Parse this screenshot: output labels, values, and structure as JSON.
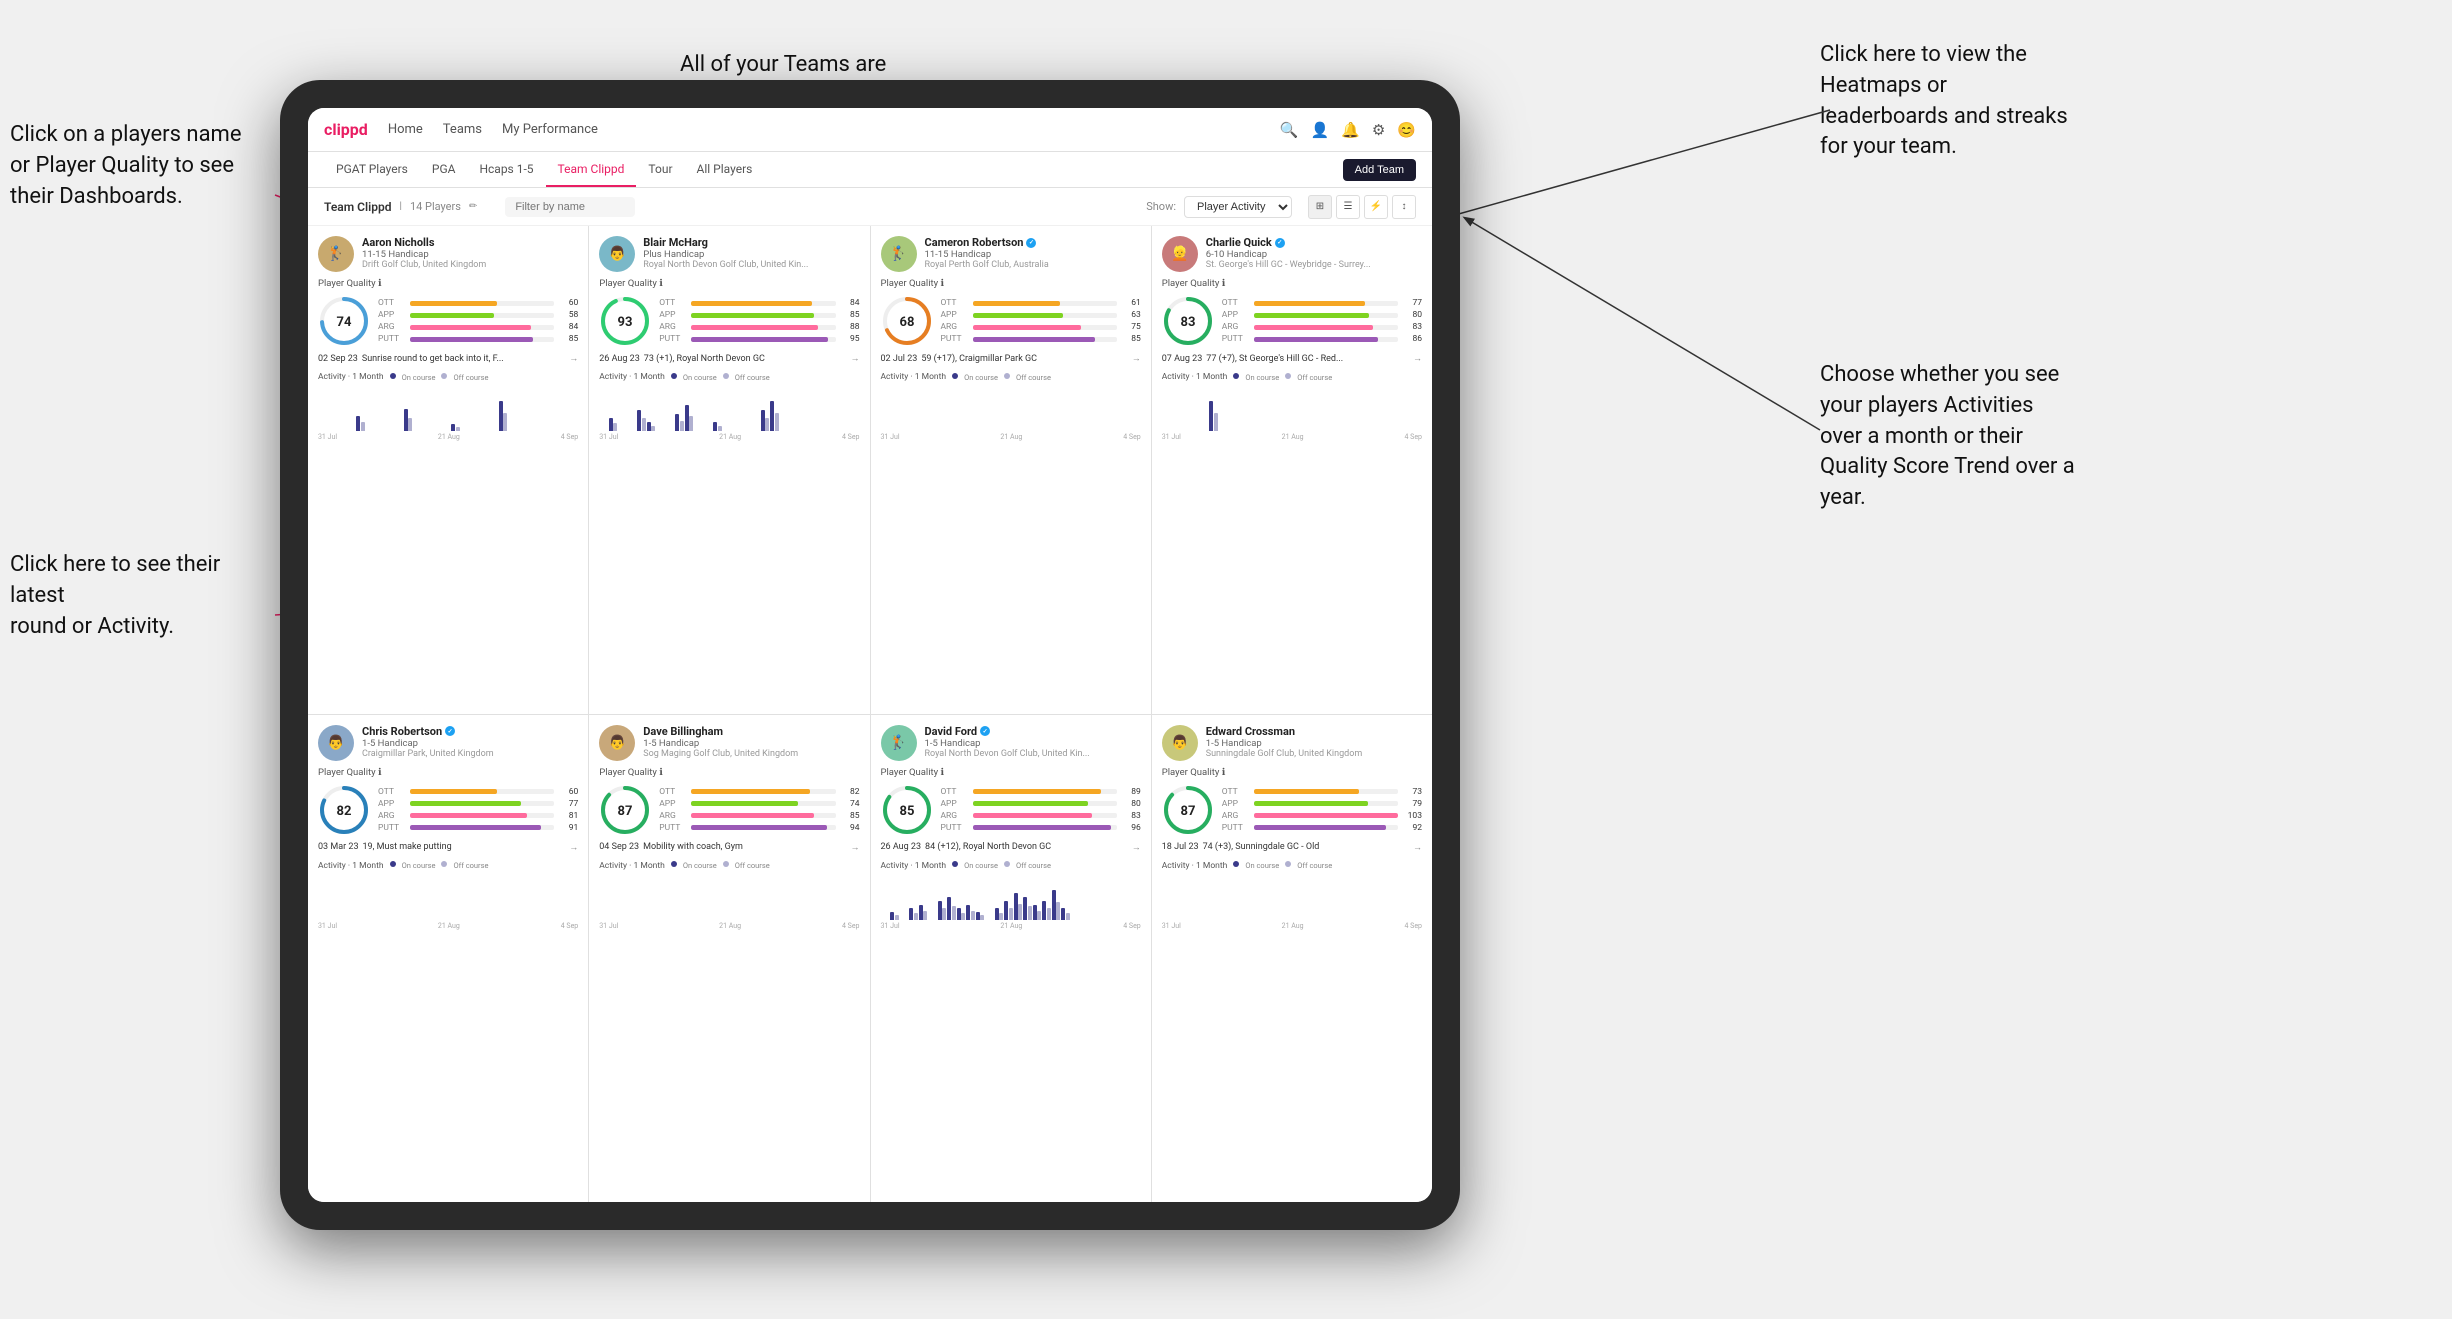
{
  "annotations": {
    "top_center": "All of your Teams are here.",
    "top_right_title": "Click here to view the",
    "top_right_body": "Heatmaps or leaderboards\nand streaks for your team.",
    "left_top_title": "Click on a players name",
    "left_top_body": "or Player Quality to see\ntheir Dashboards.",
    "left_bottom_title": "Click here to see their latest",
    "left_bottom_body": "round or Activity.",
    "right_bottom_title": "Choose whether you see",
    "right_bottom_body": "your players Activities over\na month or their Quality\nScore Trend over a year."
  },
  "nav": {
    "logo": "clippd",
    "items": [
      "Home",
      "Teams",
      "My Performance"
    ],
    "add_team": "Add Team"
  },
  "sub_nav": {
    "items": [
      "PGAT Players",
      "PGA",
      "Hcaps 1-5",
      "Team Clippd",
      "Tour",
      "All Players"
    ]
  },
  "team": {
    "name": "Team Clippd",
    "count": "14 Players",
    "search_placeholder": "Filter by name",
    "show_label": "Show:",
    "show_value": "Player Activity"
  },
  "players": [
    {
      "name": "Aaron Nicholls",
      "handicap": "11-15 Handicap",
      "club": "Drift Golf Club, United Kingdom",
      "score": 74,
      "score_color": "#4a9fd8",
      "stats": [
        {
          "label": "OTT",
          "value": 60,
          "color": "#f5a623"
        },
        {
          "label": "APP",
          "value": 58,
          "color": "#7ed321"
        },
        {
          "label": "ARG",
          "value": 84,
          "color": "#ff6b9d"
        },
        {
          "label": "PUTT",
          "value": 85,
          "color": "#9b59b6"
        }
      ],
      "recent_date": "02 Sep 23",
      "recent_text": "Sunrise round to get back into it, F...",
      "chart_bars": [
        0,
        0,
        0,
        0,
        2,
        0,
        0,
        0,
        0,
        3,
        0,
        0,
        0,
        0,
        1,
        0,
        0,
        0,
        0,
        4
      ]
    },
    {
      "name": "Blair McHarg",
      "handicap": "Plus Handicap",
      "club": "Royal North Devon Golf Club, United Kin...",
      "score": 93,
      "score_color": "#2ecc71",
      "stats": [
        {
          "label": "OTT",
          "value": 84,
          "color": "#f5a623"
        },
        {
          "label": "APP",
          "value": 85,
          "color": "#7ed321"
        },
        {
          "label": "ARG",
          "value": 88,
          "color": "#ff6b9d"
        },
        {
          "label": "PUTT",
          "value": 95,
          "color": "#9b59b6"
        }
      ],
      "recent_date": "26 Aug 23",
      "recent_text": "73 (+1), Royal North Devon GC",
      "chart_bars": [
        0,
        3,
        0,
        0,
        5,
        2,
        0,
        0,
        4,
        6,
        0,
        0,
        2,
        0,
        0,
        0,
        0,
        5,
        7,
        0
      ]
    },
    {
      "name": "Cameron Robertson",
      "handicap": "11-15 Handicap",
      "club": "Royal Perth Golf Club, Australia",
      "score": 68,
      "score_color": "#e67e22",
      "verified": true,
      "stats": [
        {
          "label": "OTT",
          "value": 61,
          "color": "#f5a623"
        },
        {
          "label": "APP",
          "value": 63,
          "color": "#7ed321"
        },
        {
          "label": "ARG",
          "value": 75,
          "color": "#ff6b9d"
        },
        {
          "label": "PUTT",
          "value": 85,
          "color": "#9b59b6"
        }
      ],
      "recent_date": "02 Jul 23",
      "recent_text": "59 (+17), Craigmillar Park GC",
      "chart_bars": [
        0,
        0,
        0,
        0,
        0,
        0,
        0,
        0,
        0,
        0,
        0,
        0,
        0,
        0,
        0,
        0,
        0,
        0,
        0,
        0
      ]
    },
    {
      "name": "Charlie Quick",
      "handicap": "6-10 Handicap",
      "club": "St. George's Hill GC - Weybridge - Surrey...",
      "score": 83,
      "score_color": "#27ae60",
      "verified": true,
      "stats": [
        {
          "label": "OTT",
          "value": 77,
          "color": "#f5a623"
        },
        {
          "label": "APP",
          "value": 80,
          "color": "#7ed321"
        },
        {
          "label": "ARG",
          "value": 83,
          "color": "#ff6b9d"
        },
        {
          "label": "PUTT",
          "value": 86,
          "color": "#9b59b6"
        }
      ],
      "recent_date": "07 Aug 23",
      "recent_text": "77 (+7), St George's Hill GC - Red...",
      "chart_bars": [
        0,
        0,
        0,
        0,
        0,
        2,
        0,
        0,
        0,
        0,
        0,
        0,
        0,
        0,
        0,
        0,
        0,
        0,
        0,
        0
      ]
    },
    {
      "name": "Chris Robertson",
      "handicap": "1-5 Handicap",
      "club": "Craigmillar Park, United Kingdom",
      "score": 82,
      "score_color": "#2980b9",
      "verified": true,
      "stats": [
        {
          "label": "OTT",
          "value": 60,
          "color": "#f5a623"
        },
        {
          "label": "APP",
          "value": 77,
          "color": "#7ed321"
        },
        {
          "label": "ARG",
          "value": 81,
          "color": "#ff6b9d"
        },
        {
          "label": "PUTT",
          "value": 91,
          "color": "#9b59b6"
        }
      ],
      "recent_date": "03 Mar 23",
      "recent_text": "19, Must make putting",
      "chart_bars": [
        0,
        0,
        0,
        0,
        0,
        0,
        0,
        0,
        0,
        0,
        0,
        0,
        0,
        0,
        0,
        0,
        0,
        0,
        0,
        0
      ]
    },
    {
      "name": "Dave Billingham",
      "handicap": "1-5 Handicap",
      "club": "Sog Maging Golf Club, United Kingdom",
      "score": 87,
      "score_color": "#27ae60",
      "stats": [
        {
          "label": "OTT",
          "value": 82,
          "color": "#f5a623"
        },
        {
          "label": "APP",
          "value": 74,
          "color": "#7ed321"
        },
        {
          "label": "ARG",
          "value": 85,
          "color": "#ff6b9d"
        },
        {
          "label": "PUTT",
          "value": 94,
          "color": "#9b59b6"
        }
      ],
      "recent_date": "04 Sep 23",
      "recent_text": "Mobility with coach, Gym",
      "chart_bars": [
        0,
        0,
        0,
        0,
        0,
        0,
        0,
        0,
        0,
        0,
        0,
        0,
        0,
        0,
        0,
        0,
        0,
        0,
        0,
        0
      ]
    },
    {
      "name": "David Ford",
      "handicap": "1-5 Handicap",
      "club": "Royal North Devon Golf Club, United Kin...",
      "score": 85,
      "score_color": "#27ae60",
      "verified": true,
      "stats": [
        {
          "label": "OTT",
          "value": 89,
          "color": "#f5a623"
        },
        {
          "label": "APP",
          "value": 80,
          "color": "#7ed321"
        },
        {
          "label": "ARG",
          "value": 83,
          "color": "#ff6b9d"
        },
        {
          "label": "PUTT",
          "value": 96,
          "color": "#9b59b6"
        }
      ],
      "recent_date": "26 Aug 23",
      "recent_text": "84 (+12), Royal North Devon GC",
      "chart_bars": [
        0,
        2,
        0,
        3,
        4,
        0,
        5,
        6,
        3,
        4,
        2,
        0,
        3,
        5,
        7,
        6,
        4,
        5,
        8,
        3
      ]
    },
    {
      "name": "Edward Crossman",
      "handicap": "1-5 Handicap",
      "club": "Sunningdale Golf Club, United Kingdom",
      "score": 87,
      "score_color": "#27ae60",
      "stats": [
        {
          "label": "OTT",
          "value": 73,
          "color": "#f5a623"
        },
        {
          "label": "APP",
          "value": 79,
          "color": "#7ed321"
        },
        {
          "label": "ARG",
          "value": 103,
          "color": "#ff6b9d"
        },
        {
          "label": "PUTT",
          "value": 92,
          "color": "#9b59b6"
        }
      ],
      "recent_date": "18 Jul 23",
      "recent_text": "74 (+3), Sunningdale GC - Old",
      "chart_bars": [
        0,
        0,
        0,
        0,
        0,
        0,
        0,
        0,
        0,
        0,
        0,
        0,
        0,
        0,
        0,
        0,
        0,
        0,
        0,
        0
      ]
    }
  ]
}
